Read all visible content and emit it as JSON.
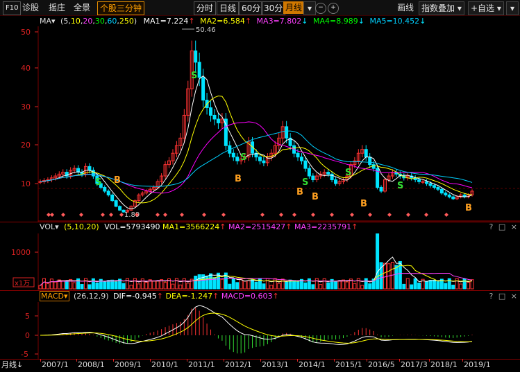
{
  "toolbar": {
    "f10": "F10",
    "diagnose": "诊股",
    "pick": "摇庄",
    "panorama": "全景",
    "stock_three_min": "个股三分钟",
    "period_tabs": [
      "分时",
      "日线",
      "60分",
      "30分",
      "月线"
    ],
    "active_tab": "月线",
    "indicator_line": "画线",
    "index_overlay": "指数叠加",
    "watchlist": "+自选"
  },
  "ma_bar": {
    "label": "MA▾",
    "params_open": "(5,",
    "p10": "10",
    "p20": "20",
    "p30": "30",
    "p60": "60",
    "p250": "250",
    "params_close": ")",
    "ma1": "MA1=7.224",
    "ma2": "MA2=6.584",
    "ma3": "MA3=7.802",
    "ma4": "MA4=8.989",
    "ma5": "MA5=10.452"
  },
  "price_panel": {
    "y_ticks": [
      "50",
      "40",
      "30",
      "20",
      "10"
    ],
    "high_label": "50.46",
    "low_label": "1.89",
    "signals_s": "S",
    "signals_b": "B"
  },
  "vol_bar": {
    "label": "VOL▾",
    "params": "(5,10,20)",
    "vol": "VOL=5793490",
    "ma1": "MA1=3566224",
    "ma2": "MA2=2515427",
    "ma3": "MA3=2235791",
    "y_tick": "1000",
    "unit": "x1万"
  },
  "macd_bar": {
    "label": "MACD▾",
    "params": "(26,12,9)",
    "dif": "DIF=-0.945",
    "dea": "DEA=-1.247",
    "macd": "MACD=0.603",
    "y_ticks": [
      "5",
      "0",
      "-5"
    ]
  },
  "x_axis": {
    "period": "月线",
    "labels": [
      "2007/1",
      "2008/1",
      "2009/1",
      "2010/1",
      "2011/1",
      "2012/1",
      "2013/1",
      "2014/1",
      "2015/1",
      "2016/5",
      "2017/3",
      "2018/1",
      "2019/1"
    ]
  },
  "panel_buttons": {
    "help": "?",
    "max": "□",
    "close": "×"
  },
  "colors": {
    "bg": "#000000",
    "up": "#ff3232",
    "down": "#00e4ff",
    "ma1": "#ffffff",
    "ma2": "#ffff00",
    "ma3": "#ff00ff",
    "ma4": "#00ff00",
    "ma5": "#00d0ff",
    "grid": "#7a0000"
  }
}
